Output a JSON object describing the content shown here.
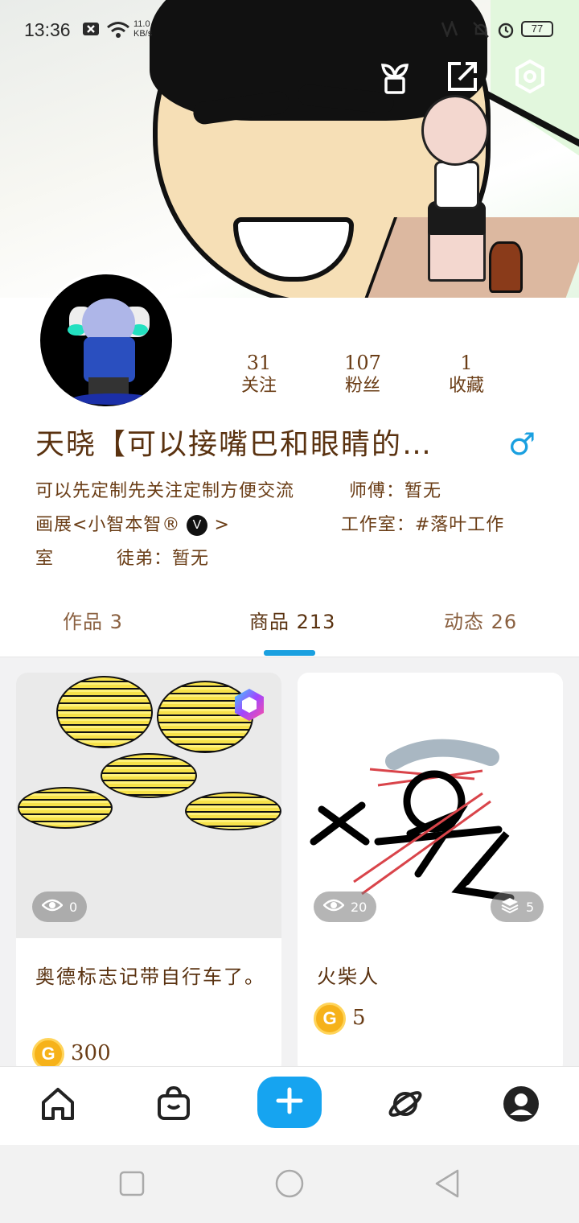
{
  "status_bar": {
    "time": "13:36",
    "net_speed": "11.0\nKB/s",
    "battery": "77"
  },
  "profile": {
    "stats": [
      {
        "value": "31",
        "label": "关注"
      },
      {
        "value": "107",
        "label": "粉丝"
      },
      {
        "value": "1",
        "label": "收藏"
      }
    ],
    "name": "天晓【可以接嘴巴和眼睛的…",
    "gender_symbol": "♂",
    "bio": {
      "line1a": "可以先定制先关注定制方便交流",
      "line1b": "师傅：暂无",
      "line2a": "画展<小智本智®",
      "line2_badge": "V",
      "line2b": ">",
      "line2c": "工作室：#落叶工作",
      "line3a": "室",
      "line3b": "徒弟：暂无"
    }
  },
  "tabs": [
    {
      "label": "作品 3"
    },
    {
      "label": "商品 213"
    },
    {
      "label": "动态 26"
    }
  ],
  "products": [
    {
      "title": "奥德标志记带自行车了。",
      "views": "0",
      "price": "300",
      "coin_letter": "G"
    },
    {
      "title": "火柴人",
      "views": "20",
      "layers": "5",
      "price": "5",
      "coin_letter": "G"
    }
  ],
  "colors": {
    "accent": "#16a4f0",
    "text_brown": "#5a3210",
    "gender_blue": "#1aa0e0"
  },
  "icons": {
    "plant": "plant-icon",
    "share": "share-icon",
    "settings": "settings-icon",
    "home": "home-icon",
    "shop": "shop-icon",
    "plus": "plus-icon",
    "planet": "planet-icon",
    "profile": "profile-icon"
  }
}
